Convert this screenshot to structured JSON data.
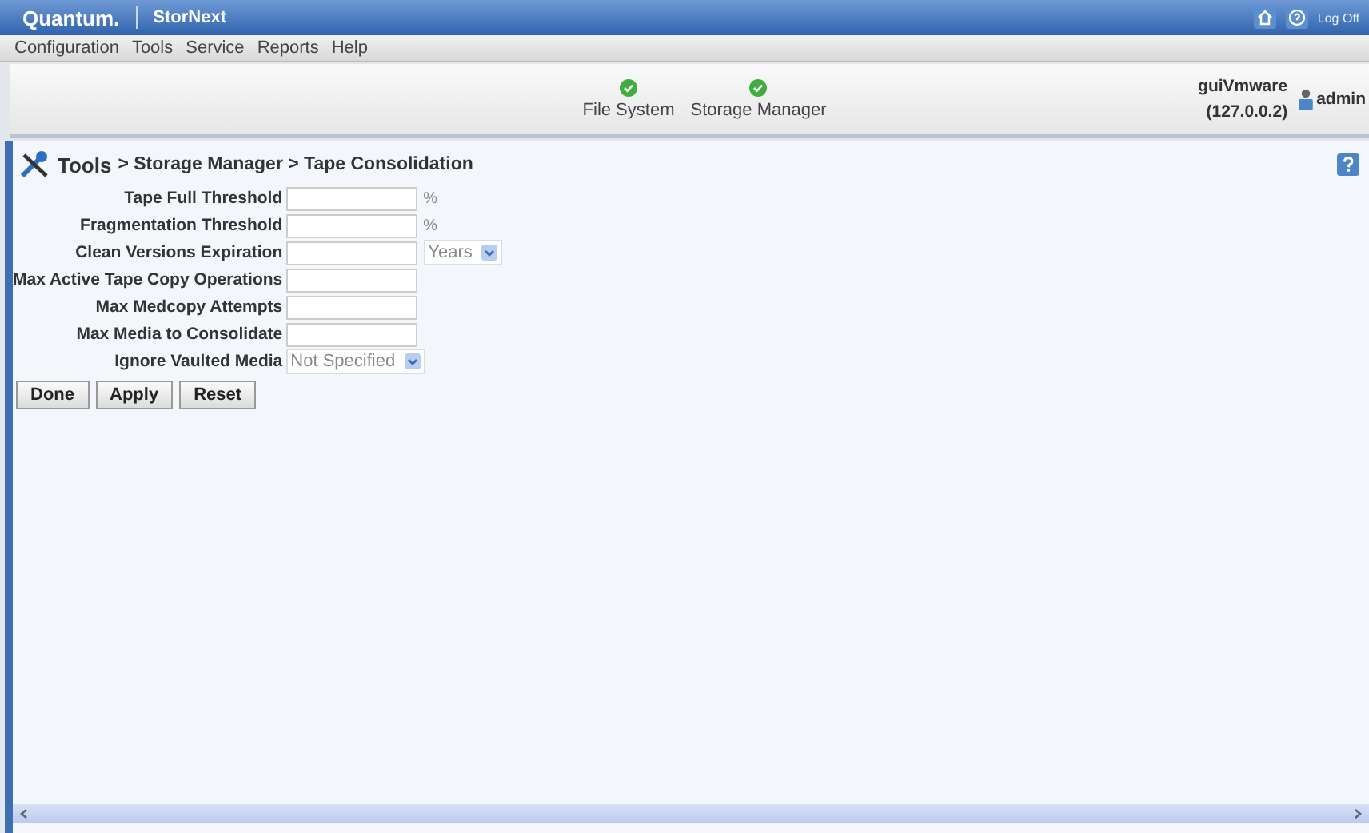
{
  "header": {
    "logo": "Quantum.",
    "product": "StorNext",
    "logoff": "Log Off"
  },
  "menu": [
    "Configuration",
    "Tools",
    "Service",
    "Reports",
    "Help"
  ],
  "status": [
    {
      "label": "File System"
    },
    {
      "label": "Storage Manager"
    }
  ],
  "host": {
    "name": "guiVmware",
    "ip": "(127.0.0.2)"
  },
  "user": "admin",
  "breadcrumb": {
    "root": "Tools",
    "path": "> Storage Manager > Tape Consolidation"
  },
  "fields": [
    {
      "label": "Tape Full Threshold",
      "kind": "text",
      "unit": "%"
    },
    {
      "label": "Fragmentation Threshold",
      "kind": "text",
      "unit": "%"
    },
    {
      "label": "Clean Versions Expiration",
      "kind": "text-select",
      "select": "Years"
    },
    {
      "label": "Max Active Tape Copy Operations",
      "kind": "text"
    },
    {
      "label": "Max Medcopy Attempts",
      "kind": "text"
    },
    {
      "label": "Max Media to Consolidate",
      "kind": "text"
    },
    {
      "label": "Ignore Vaulted Media",
      "kind": "select",
      "select": "Not Specified"
    }
  ],
  "buttons": [
    "Done",
    "Apply",
    "Reset"
  ]
}
